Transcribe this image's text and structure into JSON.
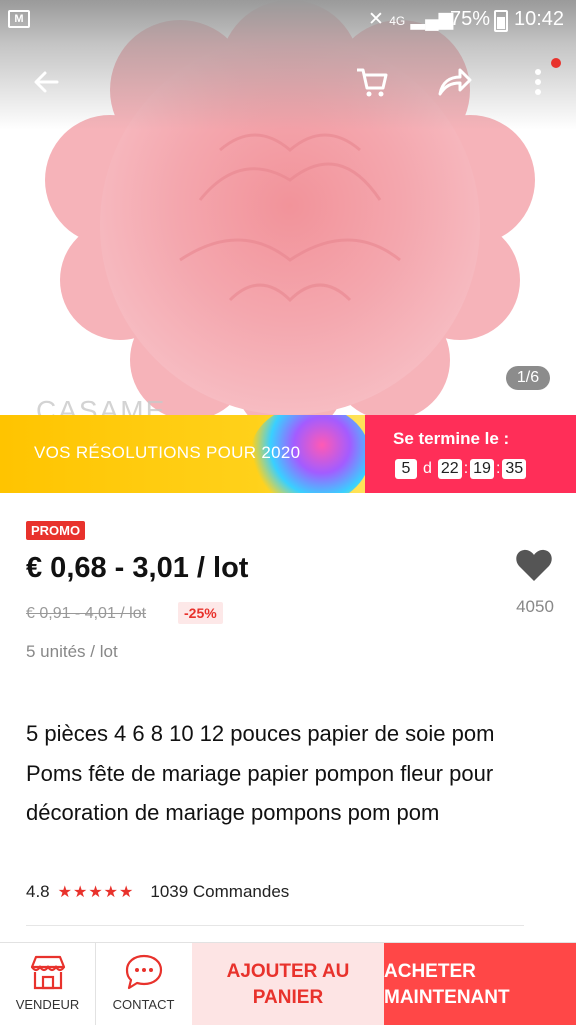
{
  "status_bar": {
    "gmail_icon": "M",
    "signal_text": "4G",
    "battery": "75%",
    "time": "10:42"
  },
  "gallery": {
    "counter": "1/6",
    "watermark": "CASAME"
  },
  "banner": {
    "text": "VOS RÉSOLUTIONS POUR 2020",
    "ends_label": "Se termine le :",
    "timer_days": "5",
    "timer_day_unit": "d",
    "timer_hours": "22",
    "timer_minutes": "19",
    "timer_seconds": "35"
  },
  "product": {
    "promo_badge": "PROMO",
    "price": "€ 0,68 - 3,01 / lot",
    "old_price": "€ 0,91 - 4,01 / lot",
    "discount": "-25%",
    "units": "5 unités / lot",
    "wishlist_count": "4050",
    "title": "5 pièces 4 6 8 10 12 pouces papier de soie pom Poms fête de mariage papier pompon fleur pour décoration de mariage pompons pom pom",
    "rating": "4.8",
    "stars": "★★★★★",
    "orders": "1039 Commandes"
  },
  "bottom_bar": {
    "seller_label": "VENDEUR",
    "contact_label": "CONTACT",
    "add_cart_line1": "AJOUTER AU",
    "add_cart_line2": "PANIER",
    "buy_line1": "ACHETER",
    "buy_line2": "MAINTENANT"
  },
  "colors": {
    "accent": "#e8322c",
    "buy_button": "#ff4747",
    "add_cart_bg": "#fde4e4",
    "banner_yellow": "#ffc400",
    "banner_pink": "#ff2e58"
  },
  "icons": [
    "back-arrow-icon",
    "cart-icon",
    "share-icon",
    "more-vert-icon",
    "heart-icon",
    "store-icon",
    "chat-icon"
  ]
}
